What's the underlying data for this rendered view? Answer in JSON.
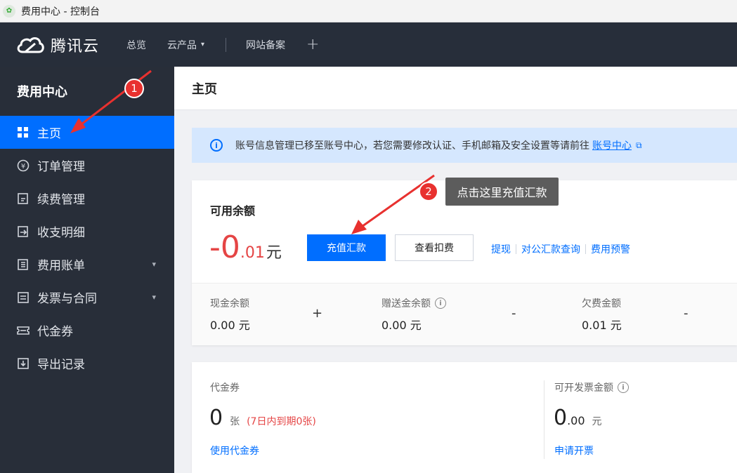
{
  "window": {
    "title": "费用中心 - 控制台"
  },
  "topnav": {
    "brand": "腾讯云",
    "items": [
      {
        "label": "总览"
      },
      {
        "label": "云产品"
      },
      {
        "label": "网站备案"
      }
    ]
  },
  "sidebar": {
    "title": "费用中心",
    "items": [
      {
        "label": "主页",
        "icon": "grid-icon"
      },
      {
        "label": "订单管理",
        "icon": "yen-circle-icon"
      },
      {
        "label": "续费管理",
        "icon": "renew-icon"
      },
      {
        "label": "收支明细",
        "icon": "transactions-icon"
      },
      {
        "label": "费用账单",
        "icon": "bill-icon"
      },
      {
        "label": "发票与合同",
        "icon": "invoice-icon"
      },
      {
        "label": "代金券",
        "icon": "voucher-icon"
      },
      {
        "label": "导出记录",
        "icon": "export-icon"
      }
    ]
  },
  "main": {
    "page_title": "主页",
    "notice": {
      "text": "账号信息管理已移至账号中心，若您需要修改认证、手机邮箱及安全设置等请前往",
      "link": "账号中心"
    },
    "balance": {
      "label": "可用余额",
      "integer": "-0",
      "decimal": ".01",
      "unit": "元",
      "recharge_button": "充值汇款",
      "deduction_button": "查看扣费",
      "links": [
        "提现",
        "对公汇款查询",
        "费用预警"
      ],
      "cash_label": "现金余额",
      "cash_value": "0.00 元",
      "plus": "+",
      "gift_label": "赠送金余额",
      "gift_value": "0.00 元",
      "minus1": "-",
      "owed_label": "欠费金额",
      "owed_value": "0.01 元",
      "minus2": "-"
    },
    "voucher": {
      "label": "代金券",
      "count": "0",
      "unit": "张",
      "expiring": "(7日内到期0张)",
      "link": "使用代金券"
    },
    "invoice": {
      "label": "可开发票金额",
      "integer": "0",
      "decimal": ".00",
      "unit": "元",
      "link": "申请开票"
    }
  },
  "annotations": {
    "badge1": "1",
    "badge2": "2",
    "tooltip": "点击这里充值汇款",
    "color": "#e8312f"
  },
  "colors": {
    "accent": "#006eff",
    "danger": "#e54545",
    "sidebar_bg": "#282e39",
    "topnav_bg": "#272e3a"
  }
}
